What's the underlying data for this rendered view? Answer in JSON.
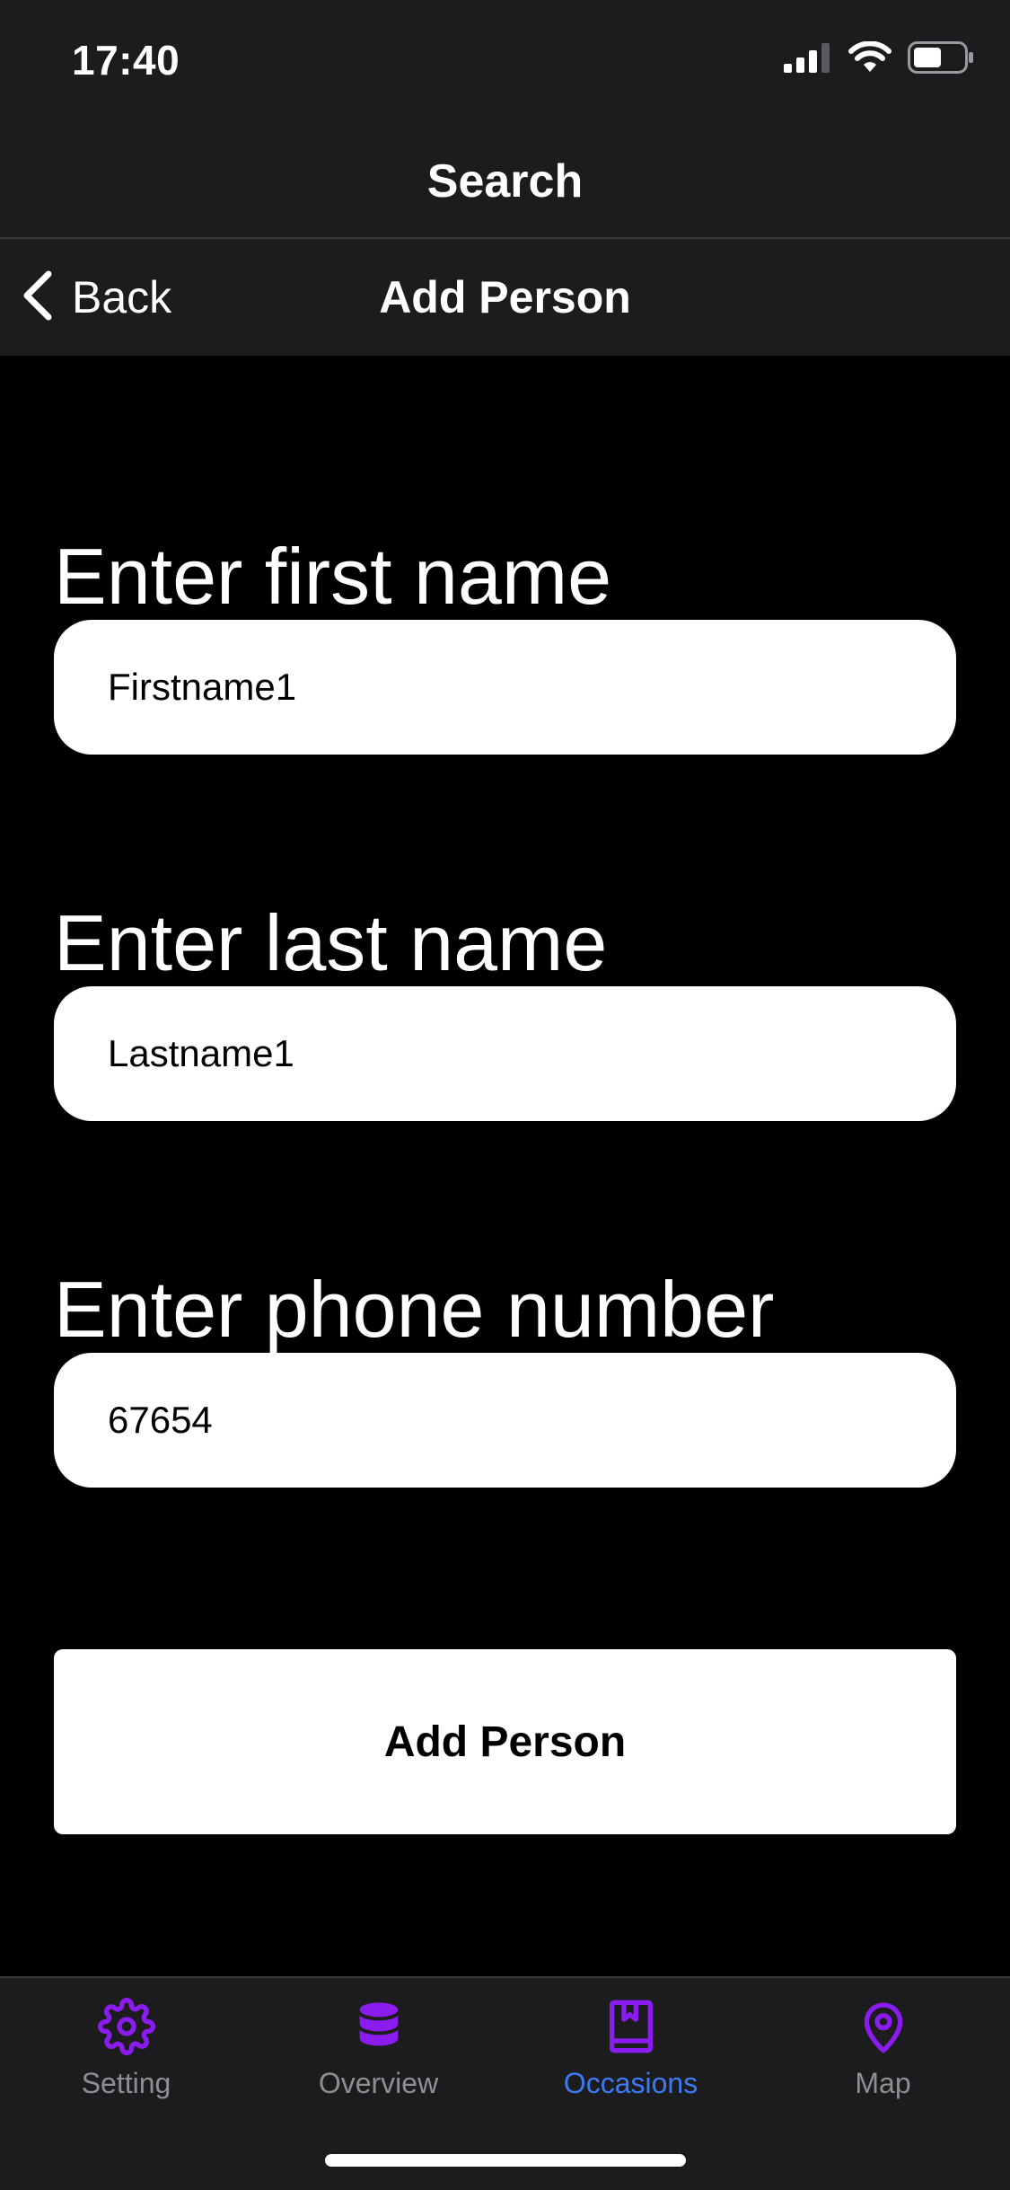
{
  "status_bar": {
    "time": "17:40"
  },
  "top_bar": {
    "title": "Search"
  },
  "nav_bar": {
    "back_label": "Back",
    "title": "Add Person"
  },
  "form": {
    "first_name": {
      "label": "Enter first name",
      "value": "Firstname1"
    },
    "last_name": {
      "label": "Enter last name",
      "value": "Lastname1"
    },
    "phone": {
      "label": "Enter phone number",
      "value": "67654"
    },
    "submit_label": "Add Person"
  },
  "tabs": [
    {
      "label": "Setting",
      "icon": "gear-icon",
      "active": false
    },
    {
      "label": "Overview",
      "icon": "database-icon",
      "active": false
    },
    {
      "label": "Occasions",
      "icon": "bookmark-book-icon",
      "active": true
    },
    {
      "label": "Map",
      "icon": "map-pin-icon",
      "active": false
    }
  ],
  "colors": {
    "background": "#000000",
    "bar_background": "#1c1c1e",
    "icon_purple": "#8a1cf0",
    "active_tab_label": "#3d7bf5",
    "inactive_tab_label": "#8e8e93"
  }
}
